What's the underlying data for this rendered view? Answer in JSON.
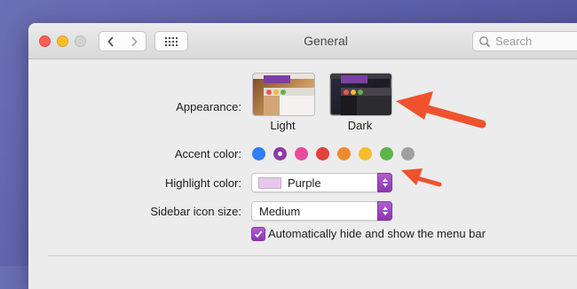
{
  "window": {
    "title": "General",
    "search_placeholder": "Search"
  },
  "appearance": {
    "label": "Appearance:",
    "options": [
      {
        "name": "Light"
      },
      {
        "name": "Dark"
      }
    ],
    "selected": "Dark"
  },
  "accent_color": {
    "label": "Accent color:",
    "swatches": [
      "#2f7ff6",
      "#8e3aa7",
      "#e74c9e",
      "#e0443a",
      "#ef8a2f",
      "#f7bd2c",
      "#5cb547",
      "#a0a0a0"
    ],
    "selected_index": 1
  },
  "highlight_color": {
    "label": "Highlight color:",
    "value": "Purple",
    "chip_color": "#e4c9ec"
  },
  "sidebar_icon_size": {
    "label": "Sidebar icon size:",
    "value": "Medium"
  },
  "menu_bar": {
    "label": "Automatically hide and show the menu bar",
    "checked": true
  },
  "colors": {
    "accent": "#9b46bf",
    "annotation_arrow": "#f0522d"
  }
}
